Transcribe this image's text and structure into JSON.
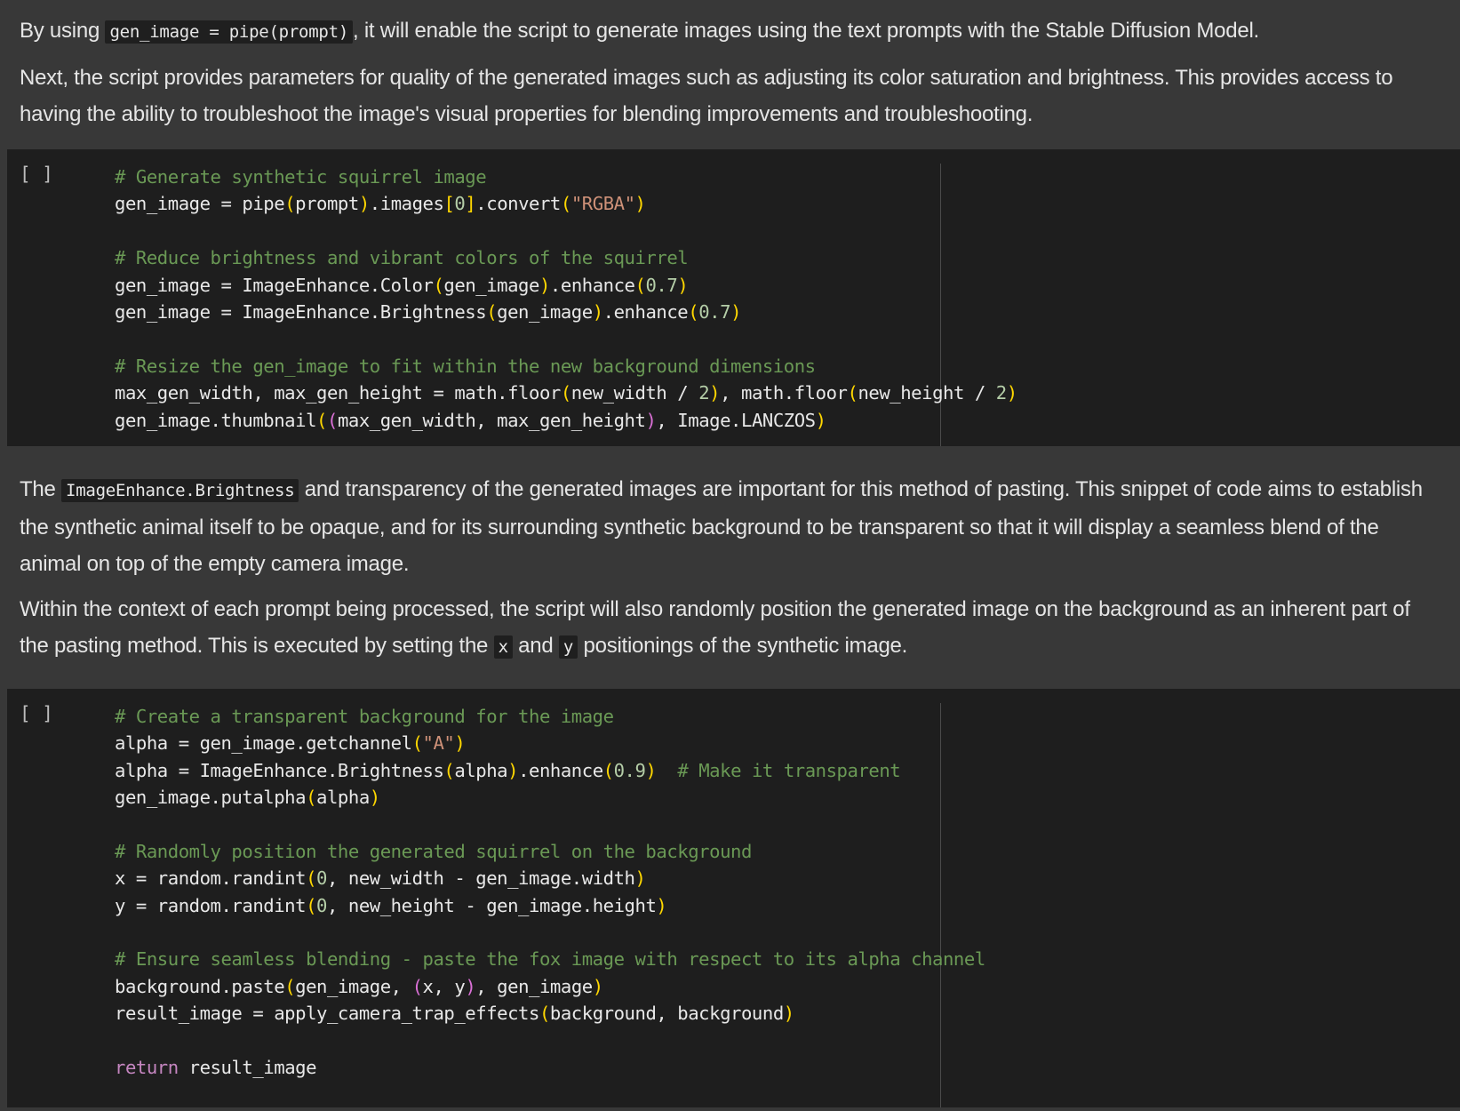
{
  "intro": {
    "p1_pre": "By using ",
    "p1_code": "gen_image = pipe(prompt)",
    "p1_post": ", it will enable the script to generate images using the text prompts with the Stable Diffusion Model.",
    "p2": "Next, the script provides parameters for quality of the generated images such as adjusting its color saturation and brightness. This provides access to having the ability to troubleshoot the image's visual properties for blending improvements and troubleshooting."
  },
  "cell1": {
    "run_label": "[ ]",
    "lines": [
      [
        {
          "t": "# Generate synthetic squirrel image",
          "c": "cm"
        }
      ],
      [
        {
          "t": "gen_image = pipe",
          "c": "tx"
        },
        {
          "t": "(",
          "c": "p1"
        },
        {
          "t": "prompt",
          "c": "tx"
        },
        {
          "t": ")",
          "c": "p1"
        },
        {
          "t": ".images",
          "c": "tx"
        },
        {
          "t": "[",
          "c": "p1"
        },
        {
          "t": "0",
          "c": "nm"
        },
        {
          "t": "]",
          "c": "p1"
        },
        {
          "t": ".convert",
          "c": "tx"
        },
        {
          "t": "(",
          "c": "p1"
        },
        {
          "t": "\"RGBA\"",
          "c": "st"
        },
        {
          "t": ")",
          "c": "p1"
        }
      ],
      [],
      [
        {
          "t": "# Reduce brightness and vibrant colors of the squirrel",
          "c": "cm"
        }
      ],
      [
        {
          "t": "gen_image = ImageEnhance.Color",
          "c": "tx"
        },
        {
          "t": "(",
          "c": "p1"
        },
        {
          "t": "gen_image",
          "c": "tx"
        },
        {
          "t": ")",
          "c": "p1"
        },
        {
          "t": ".enhance",
          "c": "tx"
        },
        {
          "t": "(",
          "c": "p1"
        },
        {
          "t": "0.7",
          "c": "nm"
        },
        {
          "t": ")",
          "c": "p1"
        }
      ],
      [
        {
          "t": "gen_image = ImageEnhance.Brightness",
          "c": "tx"
        },
        {
          "t": "(",
          "c": "p1"
        },
        {
          "t": "gen_image",
          "c": "tx"
        },
        {
          "t": ")",
          "c": "p1"
        },
        {
          "t": ".enhance",
          "c": "tx"
        },
        {
          "t": "(",
          "c": "p1"
        },
        {
          "t": "0.7",
          "c": "nm"
        },
        {
          "t": ")",
          "c": "p1"
        }
      ],
      [],
      [
        {
          "t": "# Resize the gen_image to fit within the new background dimensions",
          "c": "cm"
        }
      ],
      [
        {
          "t": "max_gen_width, max_gen_height = math.floor",
          "c": "tx"
        },
        {
          "t": "(",
          "c": "p1"
        },
        {
          "t": "new_width / ",
          "c": "tx"
        },
        {
          "t": "2",
          "c": "nm"
        },
        {
          "t": ")",
          "c": "p1"
        },
        {
          "t": ", math.floor",
          "c": "tx"
        },
        {
          "t": "(",
          "c": "p1"
        },
        {
          "t": "new_height / ",
          "c": "tx"
        },
        {
          "t": "2",
          "c": "nm"
        },
        {
          "t": ")",
          "c": "p1"
        }
      ],
      [
        {
          "t": "gen_image.thumbnail",
          "c": "tx"
        },
        {
          "t": "(",
          "c": "p1"
        },
        {
          "t": "(",
          "c": "p2"
        },
        {
          "t": "max_gen_width, max_gen_height",
          "c": "tx"
        },
        {
          "t": ")",
          "c": "p2"
        },
        {
          "t": ", Image.LANCZOS",
          "c": "tx"
        },
        {
          "t": ")",
          "c": "p1"
        }
      ]
    ]
  },
  "middle": {
    "p1_pre": "The ",
    "p1_code": "ImageEnhance.Brightness",
    "p1_post": " and transparency of the generated images are important for this method of pasting. This snippet of code aims to establish the synthetic animal itself to be opaque, and for its surrounding synthetic background to be transparent so that it will display a seamless blend of the animal on top of the empty camera image.",
    "p2_a": "Within the context of each prompt being processed, the script will also randomly position the generated image on the background as an inherent part of the pasting method. This is executed by setting the ",
    "p2_x": "x",
    "p2_b": " and ",
    "p2_y": "y",
    "p2_c": " positionings of the synthetic image."
  },
  "cell2": {
    "run_label": "[ ]",
    "lines": [
      [
        {
          "t": "# Create a transparent background for the image",
          "c": "cm"
        }
      ],
      [
        {
          "t": "alpha = gen_image.getchannel",
          "c": "tx"
        },
        {
          "t": "(",
          "c": "p1"
        },
        {
          "t": "\"A\"",
          "c": "st"
        },
        {
          "t": ")",
          "c": "p1"
        }
      ],
      [
        {
          "t": "alpha = ImageEnhance.Brightness",
          "c": "tx"
        },
        {
          "t": "(",
          "c": "p1"
        },
        {
          "t": "alpha",
          "c": "tx"
        },
        {
          "t": ")",
          "c": "p1"
        },
        {
          "t": ".enhance",
          "c": "tx"
        },
        {
          "t": "(",
          "c": "p1"
        },
        {
          "t": "0.9",
          "c": "nm"
        },
        {
          "t": ")",
          "c": "p1"
        },
        {
          "t": "  ",
          "c": "tx"
        },
        {
          "t": "# Make it transparent",
          "c": "cm"
        }
      ],
      [
        {
          "t": "gen_image.putalpha",
          "c": "tx"
        },
        {
          "t": "(",
          "c": "p1"
        },
        {
          "t": "alpha",
          "c": "tx"
        },
        {
          "t": ")",
          "c": "p1"
        }
      ],
      [],
      [
        {
          "t": "# Randomly position the generated squirrel on the background",
          "c": "cm"
        }
      ],
      [
        {
          "t": "x = random.randint",
          "c": "tx"
        },
        {
          "t": "(",
          "c": "p1"
        },
        {
          "t": "0",
          "c": "nm"
        },
        {
          "t": ", new_width - gen_image.width",
          "c": "tx"
        },
        {
          "t": ")",
          "c": "p1"
        }
      ],
      [
        {
          "t": "y = random.randint",
          "c": "tx"
        },
        {
          "t": "(",
          "c": "p1"
        },
        {
          "t": "0",
          "c": "nm"
        },
        {
          "t": ", new_height - gen_image.height",
          "c": "tx"
        },
        {
          "t": ")",
          "c": "p1"
        }
      ],
      [],
      [
        {
          "t": "# Ensure seamless blending - paste the fox image with respect to its alpha channel",
          "c": "cm"
        }
      ],
      [
        {
          "t": "background.paste",
          "c": "tx"
        },
        {
          "t": "(",
          "c": "p1"
        },
        {
          "t": "gen_image, ",
          "c": "tx"
        },
        {
          "t": "(",
          "c": "p2"
        },
        {
          "t": "x, y",
          "c": "tx"
        },
        {
          "t": ")",
          "c": "p2"
        },
        {
          "t": ", gen_image",
          "c": "tx"
        },
        {
          "t": ")",
          "c": "p1"
        }
      ],
      [
        {
          "t": "result_image = apply_camera_trap_effects",
          "c": "tx"
        },
        {
          "t": "(",
          "c": "p1"
        },
        {
          "t": "background, background",
          "c": "tx"
        },
        {
          "t": ")",
          "c": "p1"
        }
      ],
      [],
      [
        {
          "t": "return",
          "c": "kw"
        },
        {
          "t": " result_image",
          "c": "tx"
        }
      ]
    ]
  }
}
